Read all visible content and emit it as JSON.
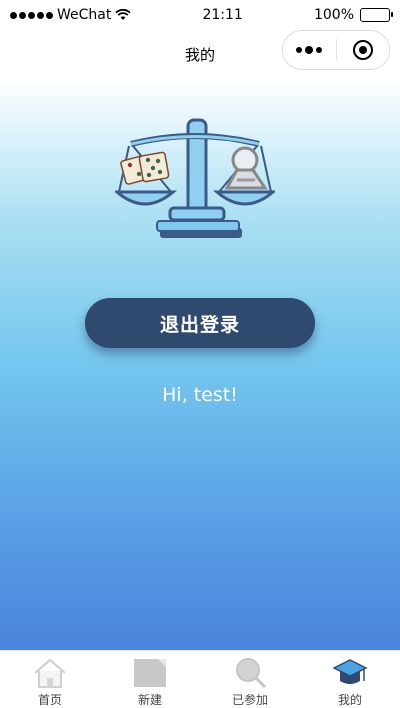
{
  "status_bar": {
    "carrier": "WeChat",
    "time": "21:11",
    "battery": "100%"
  },
  "nav": {
    "title": "我的",
    "menu_icon": "more-dots-icon",
    "close_icon": "target-icon"
  },
  "main": {
    "logo_icon": "balance-scale-icon",
    "logout_label": "退出登录",
    "greeting": "Hi, test!"
  },
  "tabs": [
    {
      "label": "首页",
      "icon": "home-icon",
      "active": false
    },
    {
      "label": "新建",
      "icon": "new-icon",
      "active": false
    },
    {
      "label": "已参加",
      "icon": "search-icon",
      "active": false
    },
    {
      "label": "我的",
      "icon": "graduation-cap-icon",
      "active": true
    }
  ],
  "colors": {
    "button_bg": "#2f4a6e",
    "gradient_top": "#ffffff",
    "gradient_bottom": "#4a83db",
    "active_tab_icon": "#4aa3e0"
  }
}
